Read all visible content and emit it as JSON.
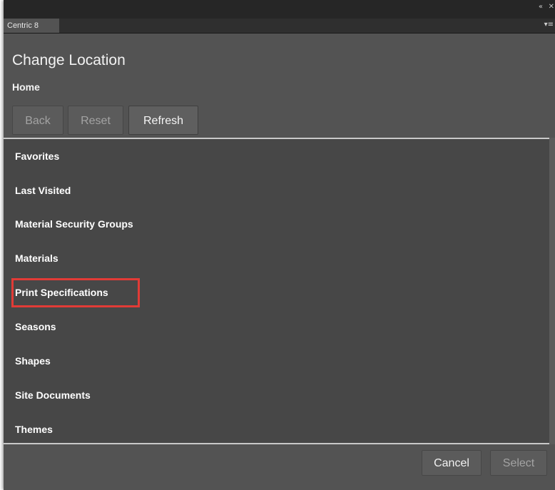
{
  "window": {
    "collapse_icon": "double-chevron-left-icon",
    "close_icon": "close-icon",
    "tab_label": "Centric 8",
    "menu_icon": "panel-menu-icon"
  },
  "panel": {
    "title": "Change Location",
    "breadcrumb": "Home"
  },
  "toolbar": {
    "back_label": "Back",
    "reset_label": "Reset",
    "refresh_label": "Refresh"
  },
  "locations": [
    {
      "label": "Favorites"
    },
    {
      "label": "Last Visited"
    },
    {
      "label": "Material Security Groups"
    },
    {
      "label": "Materials"
    },
    {
      "label": "Print Specifications",
      "highlighted": true
    },
    {
      "label": "Seasons"
    },
    {
      "label": "Shapes"
    },
    {
      "label": "Site Documents"
    },
    {
      "label": "Themes"
    }
  ],
  "footer": {
    "cancel_label": "Cancel",
    "select_label": "Select"
  },
  "colors": {
    "highlight": "#e23b36",
    "panel_background": "#535353",
    "list_background": "#474747"
  }
}
